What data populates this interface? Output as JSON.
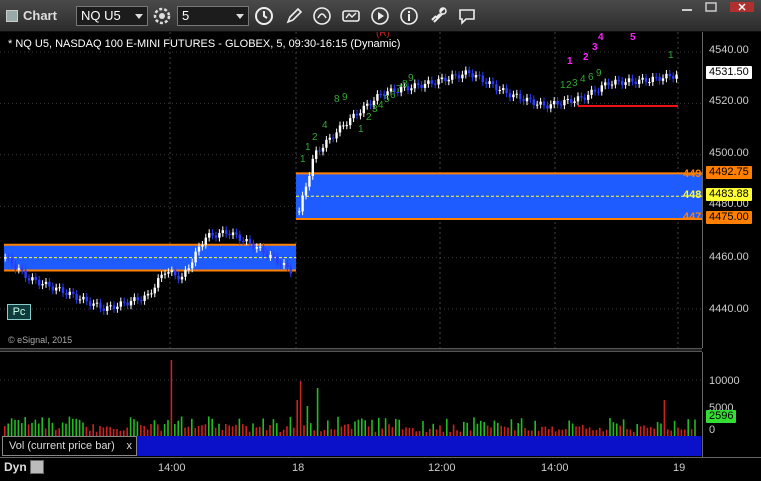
{
  "toolbar": {
    "title": "Chart",
    "symbol": "NQ U5",
    "interval": "5"
  },
  "chart": {
    "title": "* NQ U5, NASDAQ 100 E-MINI FUTURES - GLOBEX, 5, 09:30-16:15 (Dynamic)",
    "marker_r": "(R)",
    "pc_label": "Pc",
    "copyright": "© eSignal, 2015",
    "price_ticks": [
      "4540.00",
      "4520.00",
      "4500.00",
      "4480.00",
      "4460.00",
      "4440.00"
    ],
    "current_price": "4531.50",
    "level_upper": "4492.75",
    "level_mid": "4483.88",
    "level_lower": "4475.00",
    "edge_upper": "449",
    "edge_mid": "448",
    "edge_lower": "447",
    "magenta_counts": [
      "1",
      "2",
      "3",
      "4",
      "5"
    ],
    "green_count_top": "1",
    "colors": {
      "up": "#ffffff",
      "down": "#2a3cff",
      "zone": "#1f5cff",
      "level_line": "#ff8000",
      "count_green": "#33aa33",
      "count_magenta": "#ff22ff",
      "vol_up": "#22bb22",
      "vol_down": "#cc2222",
      "vol_tag": "#33dd33"
    }
  },
  "volume": {
    "ticks": [
      "10000",
      "5000",
      "0"
    ],
    "current": "2596",
    "legend": "Vol (current price bar)",
    "close_symbol": "x"
  },
  "time_axis": {
    "ticks": [
      "14:00",
      "18",
      "12:00",
      "14:00",
      "19"
    ],
    "dyn_label": "Dyn"
  }
}
